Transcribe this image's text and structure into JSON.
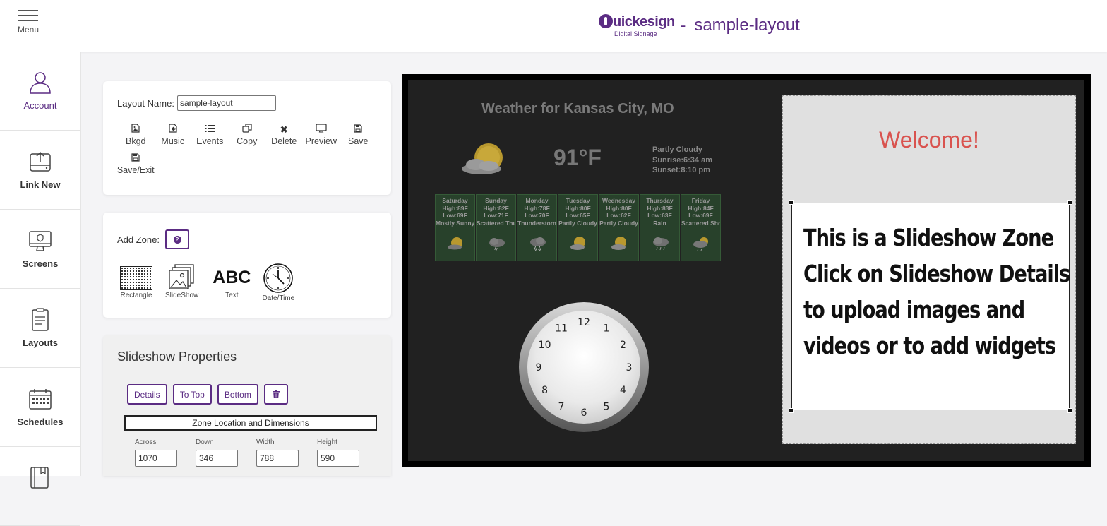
{
  "header": {
    "menu_label": "Menu",
    "logo_text": "uickesign",
    "logo_sub": "Digital Signage",
    "separator": "-",
    "title": "sample-layout"
  },
  "sidebar": {
    "items": [
      {
        "label": "Account",
        "icon": "user-icon",
        "active": true
      },
      {
        "label": "Link New",
        "icon": "link-device-icon"
      },
      {
        "label": "Screens",
        "icon": "monitor-icon"
      },
      {
        "label": "Layouts",
        "icon": "layouts-icon"
      },
      {
        "label": "Schedules",
        "icon": "calendar-icon"
      }
    ]
  },
  "layout_panel": {
    "name_label": "Layout Name:",
    "name_value": "sample-layout",
    "tools": [
      {
        "label": "Bkgd",
        "icon": "image-icon"
      },
      {
        "label": "Music",
        "icon": "music-file-icon"
      },
      {
        "label": "Events",
        "icon": "list-icon"
      },
      {
        "label": "Copy",
        "icon": "copy-icon"
      },
      {
        "label": "Delete",
        "icon": "delete-icon"
      },
      {
        "label": "Preview",
        "icon": "preview-icon"
      },
      {
        "label": "Save",
        "icon": "save-icon"
      },
      {
        "label": "Save/Exit",
        "icon": "save-exit-icon"
      }
    ]
  },
  "addzone_panel": {
    "label": "Add Zone:",
    "zones": [
      {
        "label": "Rectangle"
      },
      {
        "label": "SlideShow"
      },
      {
        "label": "Text",
        "glyph": "ABC"
      },
      {
        "label": "Date/Time"
      }
    ]
  },
  "slideshow_props": {
    "title": "Slideshow Properties",
    "buttons": [
      "Details",
      "To Top",
      "Bottom"
    ],
    "zone_header": "Zone Location and Dimensions",
    "dims": [
      {
        "label": "Across",
        "value": "1070"
      },
      {
        "label": "Down",
        "value": "346"
      },
      {
        "label": "Width",
        "value": "788"
      },
      {
        "label": "Height",
        "value": "590"
      }
    ]
  },
  "canvas": {
    "weather": {
      "title": "Weather for Kansas City, MO",
      "temp": "91°F",
      "condition": "Partly Cloudy",
      "sunrise": "Sunrise:6:34 am",
      "sunset": "Sunset:8:10 pm",
      "forecast": [
        {
          "day": "Saturday",
          "high": "High:89F",
          "low": "Low:69F",
          "cond": "Mostly Sunny"
        },
        {
          "day": "Sunday",
          "high": "High:82F",
          "low": "Low:71F",
          "cond": "Scattered Thu"
        },
        {
          "day": "Monday",
          "high": "High:78F",
          "low": "Low:70F",
          "cond": "Thunderstorms"
        },
        {
          "day": "Tuesday",
          "high": "High:80F",
          "low": "Low:65F",
          "cond": "Partly Cloudy"
        },
        {
          "day": "Wednesday",
          "high": "High:80F",
          "low": "Low:62F",
          "cond": "Partly Cloudy"
        },
        {
          "day": "Thursday",
          "high": "High:83F",
          "low": "Low:63F",
          "cond": "Rain"
        },
        {
          "day": "Friday",
          "high": "High:84F",
          "low": "Low:69F",
          "cond": "Scattered Sho"
        }
      ]
    },
    "clock_numbers": [
      "12",
      "1",
      "2",
      "3",
      "4",
      "5",
      "6",
      "7",
      "8",
      "9",
      "10",
      "11"
    ],
    "welcome": "Welcome!",
    "slideshow_lines": [
      "This is a Slideshow Zone",
      "Click on Slideshow Details",
      "to upload images and",
      "videos or to add widgets"
    ]
  },
  "colors": {
    "brand": "#5b2c83",
    "welcome": "#d9534f",
    "forecast_bg": "#28412b"
  }
}
